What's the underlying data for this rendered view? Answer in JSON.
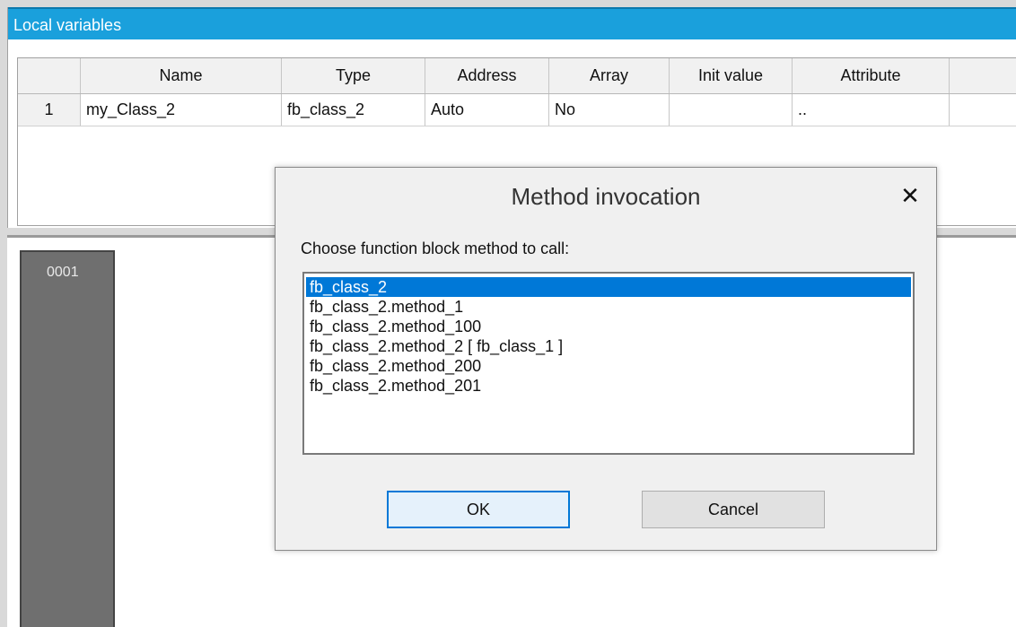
{
  "local_vars": {
    "title": "Local variables",
    "columns": [
      "",
      "Name",
      "Type",
      "Address",
      "Array",
      "Init value",
      "Attribute",
      ""
    ],
    "rows": [
      {
        "num": "1",
        "name": "my_Class_2",
        "type": "fb_class_2",
        "address": "Auto",
        "array": "No",
        "init": "",
        "attribute": ".."
      }
    ]
  },
  "editor": {
    "line_number": "0001"
  },
  "dialog": {
    "title": "Method invocation",
    "close_glyph": "✕",
    "prompt": "Choose function block method to call:",
    "options": [
      "fb_class_2",
      "fb_class_2.method_1",
      "fb_class_2.method_100",
      "fb_class_2.method_2  [ fb_class_1 ]",
      "fb_class_2.method_200",
      "fb_class_2.method_201"
    ],
    "selected_index": 0,
    "ok_label": "OK",
    "cancel_label": "Cancel"
  },
  "colors": {
    "title_bar": "#1aa0dc",
    "selection": "#0078d7"
  }
}
